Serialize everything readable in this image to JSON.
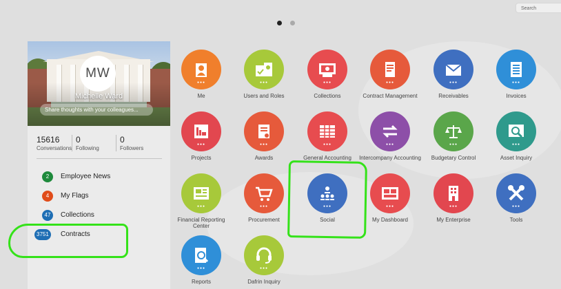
{
  "search": {
    "placeholder": "Search"
  },
  "pager": {
    "pages": 2,
    "active": 1
  },
  "profile": {
    "initials": "MW",
    "name": "Michelle Ward",
    "share_placeholder": "Share thoughts with your colleagues...",
    "stats": [
      {
        "value": "15616",
        "label": "Conversations"
      },
      {
        "value": "0",
        "label": "Following"
      },
      {
        "value": "0",
        "label": "Followers"
      }
    ],
    "menu": [
      {
        "count": "2",
        "label": "Employee News",
        "color": "#1e8a3c"
      },
      {
        "count": "4",
        "label": "My Flags",
        "color": "#e04c1a"
      },
      {
        "count": "47",
        "label": "Collections",
        "color": "#1e6eb4"
      },
      {
        "count": "3751",
        "label": "Contracts",
        "color": "#1e6eb4"
      }
    ]
  },
  "apps": [
    {
      "label": "Me",
      "color": "#f07f2c",
      "icon": "person-icon"
    },
    {
      "label": "Users and Roles",
      "color": "#a7c93a",
      "icon": "users-roles-icon"
    },
    {
      "label": "Collections",
      "color": "#e74c4f",
      "icon": "collections-icon"
    },
    {
      "label": "Contract Management",
      "color": "#e65a3b",
      "icon": "contract-icon"
    },
    {
      "label": "Receivables",
      "color": "#3f6fc0",
      "icon": "envelope-icon"
    },
    {
      "label": "Invoices",
      "color": "#2f8fd8",
      "icon": "invoice-icon"
    },
    {
      "label": "Projects",
      "color": "#e2474f",
      "icon": "chart-icon"
    },
    {
      "label": "Awards",
      "color": "#e65a3b",
      "icon": "award-icon"
    },
    {
      "label": "General Accounting",
      "color": "#e74c4f",
      "icon": "ledger-icon"
    },
    {
      "label": "Intercompany Accounting",
      "color": "#8d4fa8",
      "icon": "exchange-icon"
    },
    {
      "label": "Budgetary Control",
      "color": "#5aa64a",
      "icon": "scale-icon"
    },
    {
      "label": "Asset Inquiry",
      "color": "#2f9a8c",
      "icon": "asset-icon"
    },
    {
      "label": "Financial Reporting Center",
      "color": "#a7c93a",
      "icon": "report-center-icon"
    },
    {
      "label": "Procurement",
      "color": "#e65a3b",
      "icon": "cart-icon"
    },
    {
      "label": "Social",
      "color": "#3f6fc0",
      "icon": "social-icon"
    },
    {
      "label": "My Dashboard",
      "color": "#e74c4f",
      "icon": "dashboard-icon"
    },
    {
      "label": "My Enterprise",
      "color": "#e2474f",
      "icon": "enterprise-icon"
    },
    {
      "label": "Tools",
      "color": "#3f6fc0",
      "icon": "tools-icon"
    },
    {
      "label": "Reports",
      "color": "#2f8fd8",
      "icon": "reports-icon"
    },
    {
      "label": "Dafrin Inquiry",
      "color": "#a7c93a",
      "icon": "headset-icon"
    }
  ],
  "annotation_color": "#34e219"
}
